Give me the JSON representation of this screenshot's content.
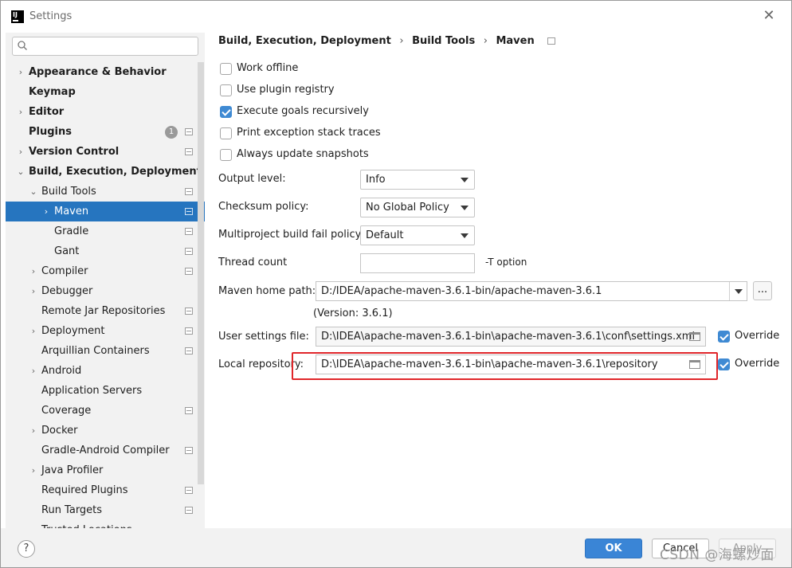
{
  "window": {
    "title": "Settings",
    "app_icon": "IJ",
    "close_glyph": "✕"
  },
  "sidebar": {
    "search_placeholder": "",
    "items": [
      {
        "label": "Appearance & Behavior",
        "level": 0,
        "arrow": "›",
        "top": true,
        "proj": false
      },
      {
        "label": "Keymap",
        "level": 0,
        "arrow": "",
        "top": true,
        "proj": false
      },
      {
        "label": "Editor",
        "level": 0,
        "arrow": "›",
        "top": true,
        "proj": false
      },
      {
        "label": "Plugins",
        "level": 0,
        "arrow": "",
        "top": true,
        "proj": true,
        "badge": "1"
      },
      {
        "label": "Version Control",
        "level": 0,
        "arrow": "›",
        "top": true,
        "proj": true
      },
      {
        "label": "Build, Execution, Deployment",
        "level": 0,
        "arrow": "⌄",
        "top": true,
        "proj": false
      },
      {
        "label": "Build Tools",
        "level": 1,
        "arrow": "⌄",
        "top": false,
        "proj": true
      },
      {
        "label": "Maven",
        "level": 2,
        "arrow": "›",
        "top": false,
        "proj": true,
        "selected": true
      },
      {
        "label": "Gradle",
        "level": 2,
        "arrow": "",
        "top": false,
        "proj": true
      },
      {
        "label": "Gant",
        "level": 2,
        "arrow": "",
        "top": false,
        "proj": true
      },
      {
        "label": "Compiler",
        "level": 1,
        "arrow": "›",
        "top": false,
        "proj": true
      },
      {
        "label": "Debugger",
        "level": 1,
        "arrow": "›",
        "top": false,
        "proj": false
      },
      {
        "label": "Remote Jar Repositories",
        "level": 1,
        "arrow": "",
        "top": false,
        "proj": true
      },
      {
        "label": "Deployment",
        "level": 1,
        "arrow": "›",
        "top": false,
        "proj": true
      },
      {
        "label": "Arquillian Containers",
        "level": 1,
        "arrow": "",
        "top": false,
        "proj": true
      },
      {
        "label": "Android",
        "level": 1,
        "arrow": "›",
        "top": false,
        "proj": false
      },
      {
        "label": "Application Servers",
        "level": 1,
        "arrow": "",
        "top": false,
        "proj": false
      },
      {
        "label": "Coverage",
        "level": 1,
        "arrow": "",
        "top": false,
        "proj": true
      },
      {
        "label": "Docker",
        "level": 1,
        "arrow": "›",
        "top": false,
        "proj": false
      },
      {
        "label": "Gradle-Android Compiler",
        "level": 1,
        "arrow": "",
        "top": false,
        "proj": true
      },
      {
        "label": "Java Profiler",
        "level": 1,
        "arrow": "›",
        "top": false,
        "proj": false
      },
      {
        "label": "Required Plugins",
        "level": 1,
        "arrow": "",
        "top": false,
        "proj": true
      },
      {
        "label": "Run Targets",
        "level": 1,
        "arrow": "",
        "top": false,
        "proj": true
      },
      {
        "label": "Trusted Locations",
        "level": 1,
        "arrow": "",
        "top": false,
        "proj": false
      }
    ]
  },
  "breadcrumb": {
    "part1": "Build, Execution, Deployment",
    "part2": "Build Tools",
    "part3": "Maven",
    "sep": "›"
  },
  "options": {
    "work_offline": "Work offline",
    "use_plugin_registry": "Use plugin registry",
    "execute_goals": "Execute goals recursively",
    "print_exception": "Print exception stack traces",
    "always_update": "Always update snapshots"
  },
  "form": {
    "output_level_label": "Output level:",
    "output_level_value": "Info",
    "checksum_label": "Checksum policy:",
    "checksum_value": "No Global Policy",
    "multiproject_label": "Multiproject build fail policy:",
    "multiproject_value": "Default",
    "thread_count_label": "Thread count",
    "thread_count_value": "",
    "thread_hint": "-T option",
    "maven_home_label": "Maven home path:",
    "maven_home_value": "D:/IDEA/apache-maven-3.6.1-bin/apache-maven-3.6.1",
    "maven_version": "(Version: 3.6.1)",
    "user_settings_label": "User settings file:",
    "user_settings_value": "D:\\IDEA\\apache-maven-3.6.1-bin\\apache-maven-3.6.1\\conf\\settings.xml",
    "local_repo_label": "Local repository:",
    "local_repo_value": "D:\\IDEA\\apache-maven-3.6.1-bin\\apache-maven-3.6.1\\repository",
    "override_label": "Override",
    "browse_label": "..."
  },
  "footer": {
    "help": "?",
    "ok": "OK",
    "cancel": "Cancel",
    "apply": "Apply"
  },
  "watermark": "CSDN @海螺炒面",
  "colors": {
    "selection": "#2675bf",
    "primary_button": "#3a85d6",
    "highlight_border": "#e0262a"
  }
}
